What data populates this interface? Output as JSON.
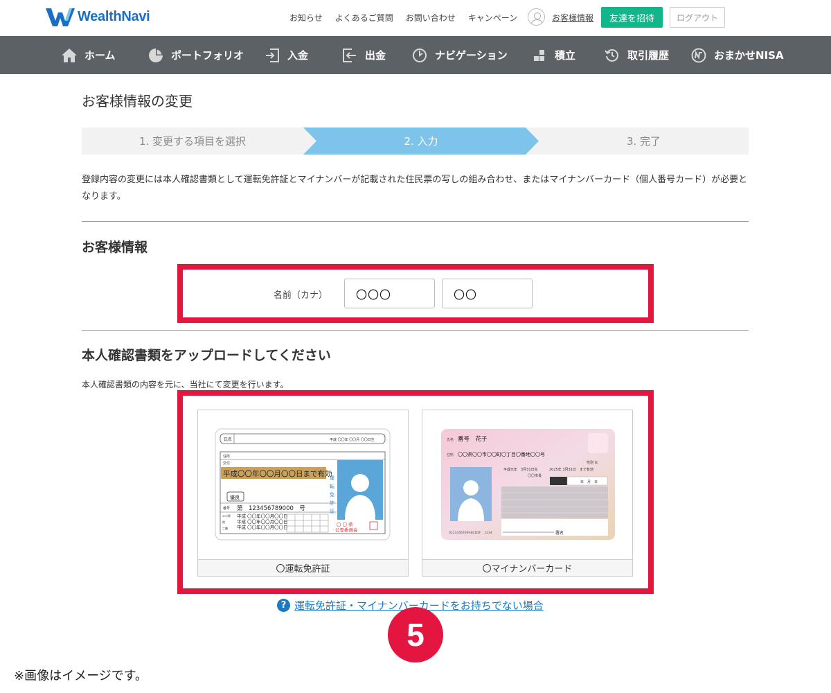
{
  "header": {
    "logo_text": "WealthNavi",
    "links": [
      "お知らせ",
      "よくあるご質問",
      "お問い合わせ",
      "キャンペーン"
    ],
    "account_label": "お客様情報",
    "invite_label": "友達を招待",
    "logout_label": "ログアウト"
  },
  "nav": {
    "items": [
      {
        "label": "ホーム",
        "icon": "home-icon"
      },
      {
        "label": "ポートフォリオ",
        "icon": "pie-chart-icon"
      },
      {
        "label": "入金",
        "icon": "deposit-icon"
      },
      {
        "label": "出金",
        "icon": "withdraw-icon"
      },
      {
        "label": "ナビゲーション",
        "icon": "navigation-icon"
      },
      {
        "label": "積立",
        "icon": "blocks-icon"
      },
      {
        "label": "取引履歴",
        "icon": "history-icon"
      },
      {
        "label": "おまかせNISA",
        "icon": "nisa-icon"
      }
    ]
  },
  "page": {
    "title": "お客様情報の変更",
    "steps": [
      "1. 変更する項目を選択",
      "2. 入力",
      "3. 完了"
    ],
    "active_step": 2,
    "description": "登録内容の変更には本人確認書類として運転免許証とマイナンバーが記載された住民票の写しの組み合わせ、またはマイナンバーカード（個人番号カード）が必要となります。"
  },
  "customer_info": {
    "section_title": "お客様情報",
    "name_label": "名前（カナ）",
    "last_name_value": "〇〇〇",
    "first_name_value": "〇〇"
  },
  "upload": {
    "section_title": "本人確認書類をアップロードしてください",
    "subtitle": "本人確認書類の内容を元に、当社にて変更を行います。",
    "options": [
      {
        "label": "運転免許証"
      },
      {
        "label": "マイナンバーカード"
      }
    ],
    "license_card": {
      "name_label": "氏名",
      "date_label": "平成 〇〇年 〇〇月 〇〇日生",
      "address_label": "住所",
      "issue_label": "交付",
      "expiry": "平成〇〇年〇〇月〇〇日まで有効",
      "grade": "優良",
      "number_label": "番号",
      "number": "第　123456789000　号",
      "history": [
        "平成 〇〇年〇〇月〇〇日",
        "平成 〇〇年〇〇月〇〇日",
        "平成 〇〇年〇〇月〇〇日"
      ],
      "history_labels": [
        "二小原",
        "他",
        "二種"
      ],
      "vertical_title": "運転免許証",
      "issuer": "〇 〇 県\n公安委員会"
    },
    "mynumber_card": {
      "name_label": "氏名",
      "name": "番号　花子",
      "address_label": "住所",
      "address": "〇〇県〇〇市〇〇町〇丁目〇番地〇〇号",
      "sex": "性別 女",
      "birth": "平成元年　3月31日生",
      "expiry": "2025年 3月31日　まで有効",
      "city": "〇〇市長",
      "date_fields": "年　月　日",
      "number": "0123456789ABCDEF　1234",
      "sign_label": "署名"
    },
    "help_link": "運転免許証・マイナンバーカードをお持ちでない場合"
  },
  "badge": "5",
  "note": "※画像はイメージです。",
  "colors": {
    "brand_blue": "#1a6fc4",
    "invite_green": "#13b58a",
    "nav_bg": "#5c6166",
    "step_active": "#7ec3ea",
    "highlight_red": "#e4163f"
  }
}
